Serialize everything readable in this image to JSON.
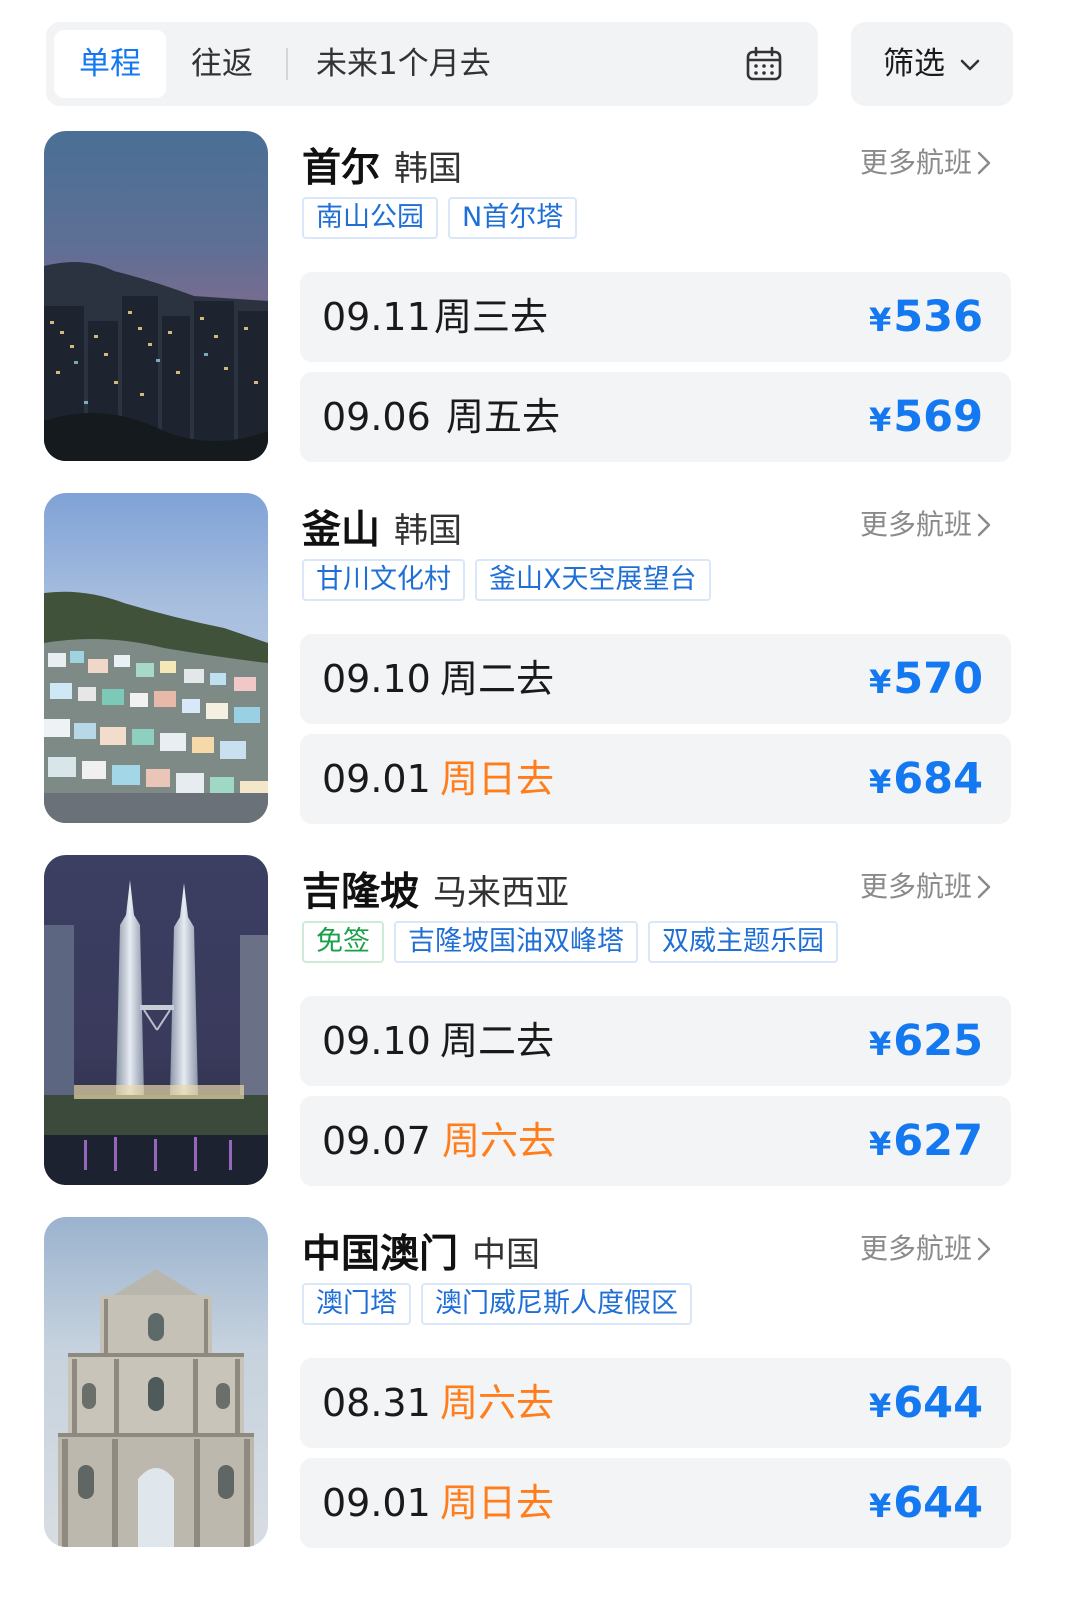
{
  "header": {
    "tabs": [
      {
        "label": "单程",
        "active": true
      },
      {
        "label": "往返",
        "active": false
      }
    ],
    "date_range": "未来1个月去",
    "calendar_icon": "calendar-icon",
    "filter_label": "筛选",
    "filter_icon": "chevron-down-icon"
  },
  "colors": {
    "accent": "#1478f0",
    "weekend": "#ff7d1a",
    "visa_free": "#1aa04b"
  },
  "destinations": [
    {
      "city": "首尔",
      "country": "韩国",
      "more": "更多航班",
      "tags": [
        {
          "label": "南山公园"
        },
        {
          "label": "N首尔塔"
        }
      ],
      "flights": [
        {
          "date": "09.11",
          "day": "周三去",
          "weekend": false,
          "currency": "¥",
          "price": "536"
        },
        {
          "date": "09.06",
          "day": "周五去",
          "weekend": false,
          "currency": "¥",
          "price": "569"
        }
      ]
    },
    {
      "city": "釜山",
      "country": "韩国",
      "more": "更多航班",
      "tags": [
        {
          "label": "甘川文化村"
        },
        {
          "label": "釜山X天空展望台"
        }
      ],
      "flights": [
        {
          "date": "09.10",
          "day": "周二去",
          "weekend": false,
          "currency": "¥",
          "price": "570"
        },
        {
          "date": "09.01",
          "day": "周日去",
          "weekend": true,
          "currency": "¥",
          "price": "684"
        }
      ]
    },
    {
      "city": "吉隆坡",
      "country": "马来西亚",
      "more": "更多航班",
      "tags": [
        {
          "label": "免签",
          "visa_free": true
        },
        {
          "label": "吉隆坡国油双峰塔"
        },
        {
          "label": "双威主题乐园"
        }
      ],
      "flights": [
        {
          "date": "09.10",
          "day": "周二去",
          "weekend": false,
          "currency": "¥",
          "price": "625"
        },
        {
          "date": "09.07",
          "day": "周六去",
          "weekend": true,
          "currency": "¥",
          "price": "627"
        }
      ]
    },
    {
      "city": "中国澳门",
      "country": "中国",
      "more": "更多航班",
      "tags": [
        {
          "label": "澳门塔"
        },
        {
          "label": "澳门威尼斯人度假区"
        }
      ],
      "flights": [
        {
          "date": "08.31",
          "day": "周六去",
          "weekend": true,
          "currency": "¥",
          "price": "644"
        },
        {
          "date": "09.01",
          "day": "周日去",
          "weekend": true,
          "currency": "¥",
          "price": "644"
        }
      ]
    }
  ]
}
